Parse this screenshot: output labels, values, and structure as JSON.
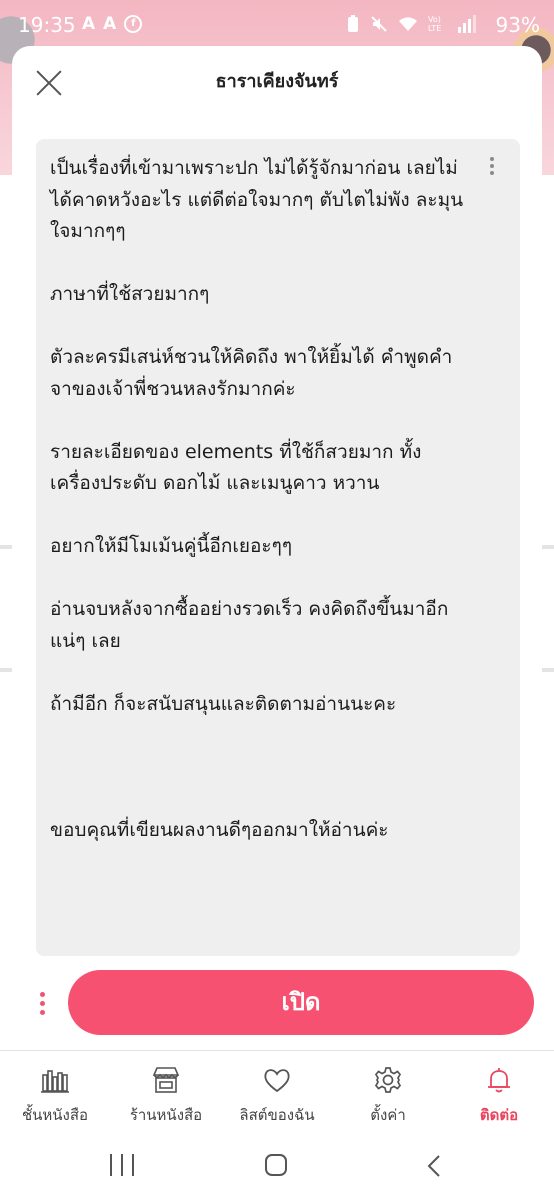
{
  "status_bar": {
    "time": "19:35",
    "left_icons": [
      "A",
      "A",
      "facebook"
    ],
    "battery": "93%",
    "network": "Vo) LTE"
  },
  "sheet": {
    "title": "ธาราเคียงจันทร์",
    "review_paragraphs": [
      "เป็นเรื่องที่เข้ามาเพราะปก ไม่ได้รู้จักมาก่อน เลยไม่ได้คาดหวังอะไร แต่ดีต่อใจมากๆ ตับไตไม่พัง ละมุนใจมากๆๆ",
      "ภาษาที่ใช้สวยมากๆ",
      "ตัวละครมีเสน่ห์ชวนให้คิดถึง พาให้ยิ้มได้ คำพูดคำจาของเจ้าพี่ชวนหลงรักมากค่ะ",
      "รายละเอียดของ elements ที่ใช้ก็สวยมาก ทั้งเครื่องประดับ ดอกไม้ และเมนูคาว หวาน",
      "อยากให้มีโมเม้นคู่นี้อีกเยอะๆๆ",
      "อ่านจบหลังจากซื้ออย่างรวดเร็ว คงคิดถึงขึ้นมาอีกแน่ๆ เลย",
      "ถ้ามีอีก ก็จะสนับสนุนและติดตามอ่านนะคะ",
      "ขอบคุณที่เขียนผลงานดีๆออกมาให้อ่านค่ะ"
    ],
    "open_button": "เปิด"
  },
  "bottom_nav": {
    "items": [
      {
        "label": "ชั้นหนังสือ",
        "icon": "bookshelf-icon"
      },
      {
        "label": "ร้านหนังสือ",
        "icon": "store-icon"
      },
      {
        "label": "ลิสต์ของฉัน",
        "icon": "heart-icon"
      },
      {
        "label": "ตั้งค่า",
        "icon": "gear-icon"
      },
      {
        "label": "ติดต่อ",
        "icon": "bell-icon"
      }
    ],
    "active_index": 4
  },
  "colors": {
    "accent": "#f75172",
    "active_nav": "#e9455f",
    "review_bg": "#efeff0",
    "header_pink": "#f3b6c1"
  }
}
